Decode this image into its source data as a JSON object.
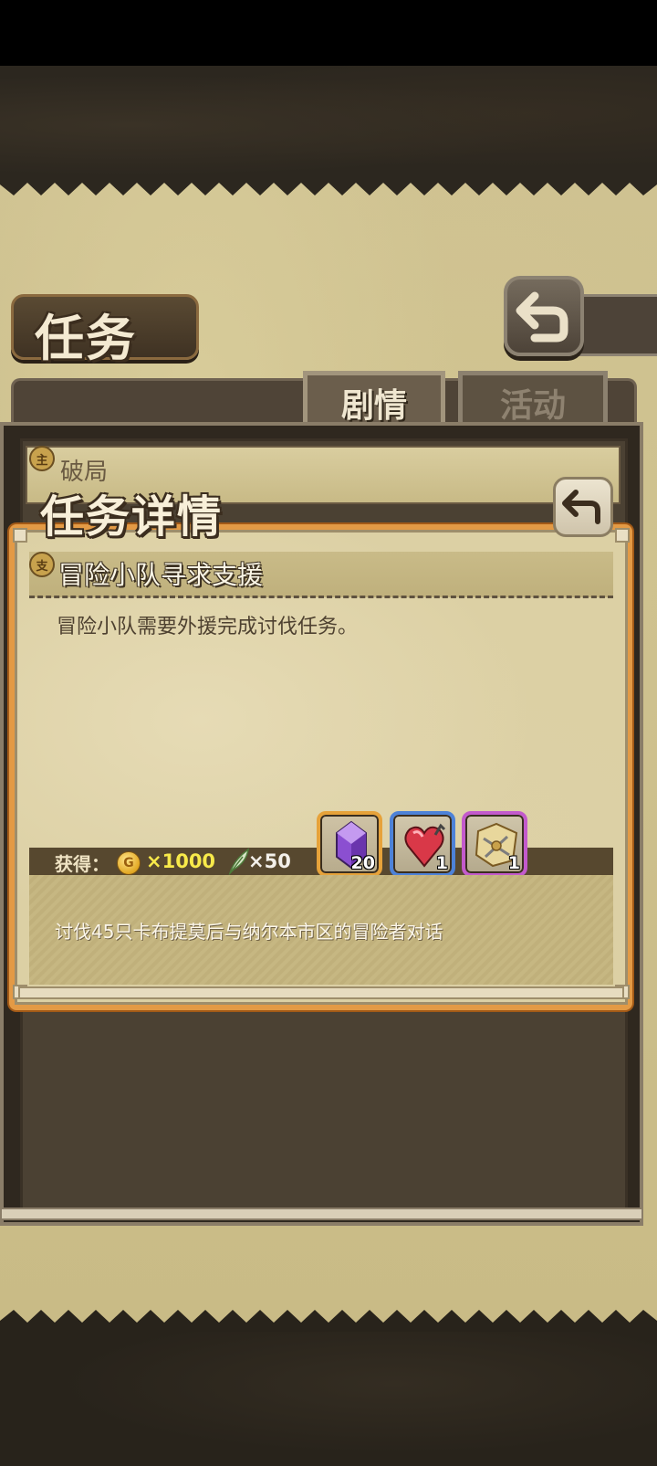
{
  "header": {
    "title": "任务",
    "back_icon": "return-arrow-icon"
  },
  "tabs": [
    {
      "label": "剧情",
      "active": true
    },
    {
      "label": "活动",
      "active": false
    }
  ],
  "quest_list": {
    "items": [
      {
        "badge": "主",
        "title": "破局"
      }
    ]
  },
  "dialog": {
    "heading": "任务详情",
    "back_icon": "return-arrow-icon",
    "quest_badge": "支",
    "quest_title": "冒险小队寻求支援",
    "description": "冒险小队需要外援完成讨伐任务。",
    "rewards": {
      "label": "获得：",
      "coin": {
        "icon": "gold-coin-icon",
        "amount": "×1000"
      },
      "feather": {
        "icon": "feather-icon",
        "amount": "×50"
      },
      "items": [
        {
          "icon": "purple-crystal-icon",
          "count": "20",
          "rarity_color": "#e6a23a"
        },
        {
          "icon": "red-heart-stone-icon",
          "count": "1",
          "rarity_color": "#4d82d8"
        },
        {
          "icon": "treasure-map-icon",
          "count": "1",
          "rarity_color": "#c35acc"
        }
      ]
    },
    "objective": "讨伐45只卡布提莫后与纳尔本市区的冒险者对话"
  },
  "colors": {
    "accent_orange": "#e39a45",
    "parchment": "#dcd0a4",
    "coin_text": "#f7e94a"
  }
}
